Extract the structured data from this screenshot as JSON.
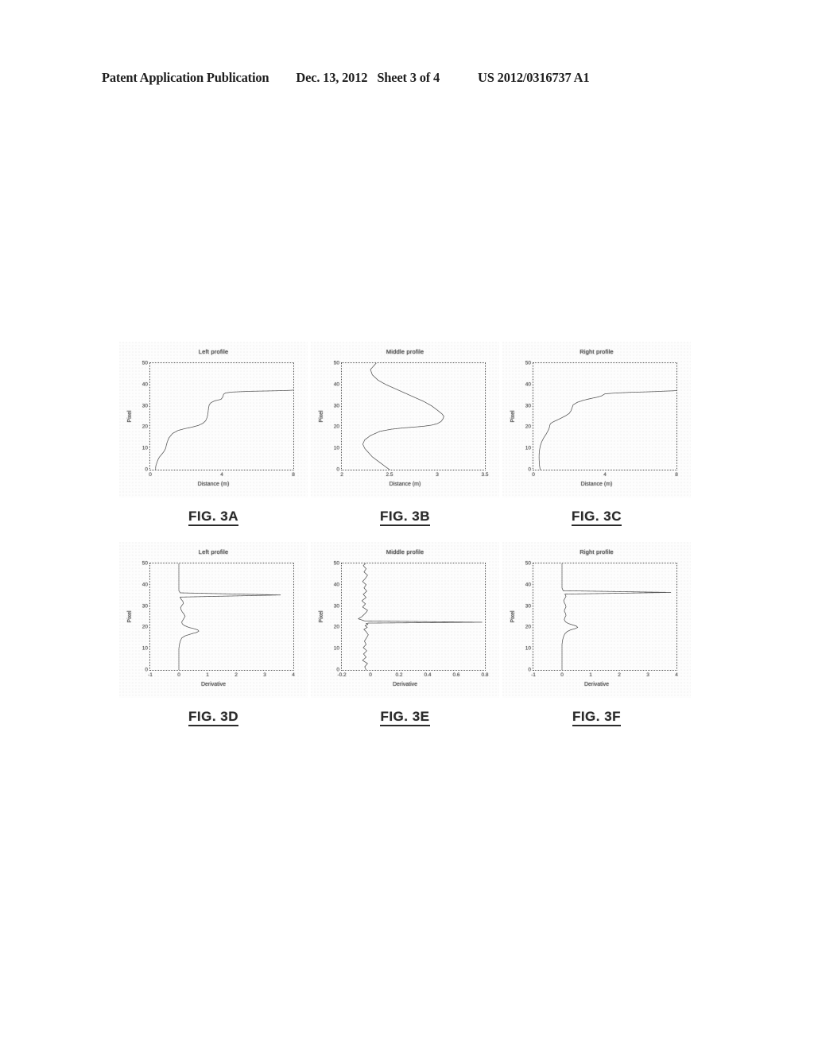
{
  "header": {
    "publication": "Patent Application Publication",
    "date": "Dec. 13, 2012",
    "sheet": "Sheet 3 of 4",
    "doc_number": "US 2012/0316737 A1"
  },
  "captions": {
    "a": "FIG. 3A",
    "b": "FIG. 3B",
    "c": "FIG. 3C",
    "d": "FIG. 3D",
    "e": "FIG. 3E",
    "f": "FIG. 3F"
  },
  "chart_data": [
    {
      "id": "fig3a",
      "type": "line",
      "title": "Left profile",
      "xlabel": "Distance (m)",
      "ylabel": "Pixel",
      "xlim": [
        0,
        8
      ],
      "ylim": [
        0,
        50
      ],
      "grid": false,
      "xticks": [
        "0",
        "4",
        "8"
      ],
      "xtick_values": [
        0,
        4,
        8
      ],
      "yticks": [
        "0",
        "10",
        "20",
        "30",
        "40",
        "50"
      ],
      "ytick_values": [
        0,
        10,
        20,
        30,
        40,
        50
      ],
      "series": [
        {
          "name": "Left profile",
          "x": [
            0.3,
            0.3,
            0.32,
            0.36,
            0.4,
            0.45,
            0.52,
            0.62,
            0.72,
            0.8,
            0.86,
            0.9,
            0.95,
            1.05,
            1.25,
            1.55,
            1.95,
            2.35,
            2.7,
            2.95,
            3.1,
            3.18,
            3.22,
            3.24,
            3.26,
            3.3,
            3.4,
            3.6,
            3.95,
            4.05,
            4.1,
            4.2,
            4.5,
            5.0,
            5.6,
            6.2,
            6.8,
            7.3,
            7.7,
            7.95,
            8.0
          ],
          "y": [
            0.0,
            1.0,
            2.0,
            3.0,
            4.0,
            5.0,
            6.0,
            7.0,
            8.0,
            9.0,
            10.0,
            11.5,
            13.0,
            15.0,
            17.0,
            18.4,
            19.3,
            20.0,
            20.8,
            21.8,
            23.0,
            24.5,
            26.0,
            27.5,
            29.0,
            30.5,
            31.5,
            32.3,
            33.0,
            34.0,
            35.4,
            36.0,
            36.4,
            36.6,
            36.8,
            36.9,
            37.0,
            37.1,
            37.2,
            37.3,
            37.4
          ]
        }
      ]
    },
    {
      "id": "fig3b",
      "type": "line",
      "title": "Middle profile",
      "xlabel": "Distance (m)",
      "ylabel": "Pixel",
      "xlim": [
        2,
        3.5
      ],
      "ylim": [
        0,
        50
      ],
      "grid": false,
      "xticks": [
        "2",
        "2.5",
        "3",
        "3.5"
      ],
      "xtick_values": [
        2,
        2.5,
        3,
        3.5
      ],
      "yticks": [
        "0",
        "10",
        "20",
        "30",
        "40",
        "50"
      ],
      "ytick_values": [
        0,
        10,
        20,
        30,
        40,
        50
      ],
      "series": [
        {
          "name": "Middle profile",
          "x": [
            2.5,
            2.44,
            2.38,
            2.32,
            2.28,
            2.24,
            2.22,
            2.24,
            2.3,
            2.4,
            2.52,
            2.64,
            2.76,
            2.86,
            2.94,
            3.0,
            3.04,
            3.06,
            3.07,
            3.05,
            3.0,
            2.94,
            2.86,
            2.76,
            2.66,
            2.56,
            2.46,
            2.38,
            2.32,
            2.3,
            2.36
          ],
          "y": [
            0.0,
            2.0,
            4.0,
            6.0,
            8.0,
            10.0,
            12.0,
            14.0,
            16.0,
            18.0,
            19.0,
            19.6,
            20.0,
            20.4,
            20.9,
            21.6,
            22.6,
            23.8,
            25.0,
            26.2,
            28.0,
            30.0,
            32.0,
            34.0,
            36.0,
            38.0,
            40.0,
            42.0,
            44.5,
            47.0,
            50.0
          ]
        }
      ]
    },
    {
      "id": "fig3c",
      "type": "line",
      "title": "Right profile",
      "xlabel": "Distance (m)",
      "ylabel": "Pixel",
      "xlim": [
        0,
        8
      ],
      "ylim": [
        0,
        50
      ],
      "grid": false,
      "xticks": [
        "0",
        "4",
        "8"
      ],
      "xtick_values": [
        0,
        4,
        8
      ],
      "yticks": [
        "0",
        "10",
        "20",
        "30",
        "40",
        "50"
      ],
      "ytick_values": [
        0,
        10,
        20,
        30,
        40,
        50
      ],
      "series": [
        {
          "name": "Right profile",
          "x": [
            0.38,
            0.36,
            0.34,
            0.33,
            0.32,
            0.32,
            0.34,
            0.38,
            0.46,
            0.58,
            0.7,
            0.8,
            0.86,
            0.9,
            0.92,
            0.96,
            1.02,
            1.12,
            1.3,
            1.55,
            1.8,
            2.0,
            2.1,
            2.16,
            2.22,
            2.45,
            2.8,
            3.2,
            3.55,
            3.8,
            4.0,
            4.6,
            5.4,
            6.2,
            6.9,
            7.4,
            7.75,
            7.95,
            8.0
          ],
          "y": [
            0.0,
            1.0,
            2.0,
            3.5,
            5.0,
            7.0,
            9.0,
            11.0,
            13.0,
            15.0,
            16.5,
            18.0,
            19.0,
            20.0,
            21.0,
            21.6,
            22.0,
            22.5,
            23.2,
            24.2,
            25.3,
            26.4,
            27.6,
            29.0,
            30.4,
            31.6,
            32.6,
            33.4,
            34.0,
            34.6,
            35.6,
            36.0,
            36.3,
            36.5,
            36.7,
            36.9,
            37.0,
            37.1,
            37.2
          ]
        }
      ]
    },
    {
      "id": "fig3d",
      "type": "line",
      "title": "Left profile",
      "xlabel": "Derivative",
      "ylabel": "Pixel",
      "xlim": [
        -1,
        4
      ],
      "ylim": [
        0,
        50
      ],
      "grid": false,
      "xticks": [
        "-1",
        "0",
        "1",
        "2",
        "3",
        "4"
      ],
      "xtick_values": [
        -1,
        0,
        1,
        2,
        3,
        4
      ],
      "yticks": [
        "0",
        "10",
        "20",
        "30",
        "40",
        "50"
      ],
      "ytick_values": [
        0,
        10,
        20,
        30,
        40,
        50
      ],
      "series": [
        {
          "name": "Left profile derivative",
          "x": [
            0.0,
            0.0,
            0.0,
            0.0,
            0.0,
            0.0,
            0.02,
            0.05,
            0.1,
            0.22,
            0.45,
            0.62,
            0.7,
            0.66,
            0.52,
            0.34,
            0.2,
            0.12,
            0.1,
            0.14,
            0.18,
            0.22,
            0.18,
            0.12,
            0.08,
            0.06,
            0.1,
            0.16,
            0.14,
            0.08,
            0.04,
            3.55,
            0.05,
            0.0,
            0.0,
            0.0,
            0.0,
            0.0,
            0.0,
            0.0,
            0.0
          ],
          "y": [
            0.0,
            2.0,
            4.0,
            6.0,
            8.0,
            10.0,
            12.0,
            13.5,
            15.0,
            16.0,
            17.0,
            17.6,
            18.2,
            18.8,
            19.4,
            20.0,
            20.8,
            21.6,
            22.5,
            23.4,
            24.3,
            25.2,
            26.2,
            27.2,
            28.2,
            29.2,
            30.2,
            31.2,
            32.2,
            33.2,
            34.2,
            35.2,
            36.2,
            37.2,
            39.0,
            41.0,
            43.0,
            45.0,
            47.0,
            49.0,
            50.0
          ]
        }
      ]
    },
    {
      "id": "fig3e",
      "type": "line",
      "title": "Middle profile",
      "xlabel": "Derivative",
      "ylabel": "Pixel",
      "xlim": [
        -0.2,
        0.8
      ],
      "ylim": [
        0,
        50
      ],
      "grid": false,
      "xticks": [
        "-0.2",
        "0",
        "0.2",
        "0.4",
        "0.6",
        "0.8"
      ],
      "xtick_values": [
        -0.2,
        0,
        0.2,
        0.4,
        0.6,
        0.8
      ],
      "yticks": [
        "0",
        "10",
        "20",
        "30",
        "40",
        "50"
      ],
      "ytick_values": [
        0,
        10,
        20,
        30,
        40,
        50
      ],
      "series": [
        {
          "name": "Middle profile derivative",
          "x": [
            -0.03,
            -0.04,
            -0.02,
            -0.055,
            -0.03,
            -0.048,
            -0.025,
            -0.05,
            -0.03,
            -0.042,
            -0.028,
            -0.015,
            -0.03,
            -0.046,
            -0.022,
            -0.038,
            -0.018,
            -0.03,
            -0.012,
            0.78,
            -0.04,
            -0.085,
            -0.06,
            -0.045,
            -0.03,
            -0.02,
            -0.055,
            -0.035,
            -0.06,
            -0.03,
            -0.05,
            -0.025,
            -0.045,
            -0.03,
            -0.055,
            -0.035,
            -0.02,
            -0.045,
            -0.03,
            -0.05,
            -0.035
          ],
          "y": [
            0.0,
            1.5,
            3.0,
            4.5,
            6.0,
            7.5,
            9.0,
            10.5,
            12.0,
            13.5,
            15.0,
            16.5,
            18.0,
            19.0,
            20.0,
            20.8,
            21.4,
            21.8,
            22.0,
            22.4,
            23.0,
            24.0,
            25.0,
            26.0,
            27.0,
            28.0,
            29.5,
            31.0,
            32.5,
            34.0,
            35.5,
            37.0,
            38.5,
            40.0,
            41.5,
            43.0,
            44.5,
            46.0,
            47.5,
            49.0,
            50.0
          ]
        }
      ]
    },
    {
      "id": "fig3f",
      "type": "line",
      "title": "Right profile",
      "xlabel": "Derivative",
      "ylabel": "Pixel",
      "xlim": [
        -1,
        4
      ],
      "ylim": [
        0,
        50
      ],
      "grid": false,
      "xticks": [
        "-1",
        "0",
        "1",
        "2",
        "3",
        "4"
      ],
      "xtick_values": [
        -1,
        0,
        1,
        2,
        3,
        4
      ],
      "yticks": [
        "0",
        "10",
        "20",
        "30",
        "40",
        "50"
      ],
      "ytick_values": [
        0,
        10,
        20,
        30,
        40,
        50
      ],
      "series": [
        {
          "name": "Right profile derivative",
          "x": [
            0.0,
            0.0,
            0.0,
            0.0,
            0.0,
            0.0,
            0.0,
            0.02,
            0.05,
            0.1,
            0.18,
            0.3,
            0.46,
            0.55,
            0.5,
            0.36,
            0.22,
            0.12,
            0.08,
            0.1,
            0.14,
            0.12,
            0.08,
            0.1,
            0.14,
            0.12,
            0.08,
            0.06,
            0.1,
            0.14,
            0.1,
            3.8,
            0.04,
            0.0,
            0.0,
            0.0,
            0.0,
            0.0,
            0.0,
            0.0,
            0.0
          ],
          "y": [
            0.0,
            2.0,
            4.0,
            6.0,
            8.0,
            10.0,
            12.0,
            14.0,
            15.5,
            17.0,
            18.0,
            18.8,
            19.4,
            20.0,
            20.6,
            21.2,
            21.8,
            22.6,
            23.6,
            24.6,
            25.6,
            26.6,
            27.6,
            28.6,
            29.6,
            30.6,
            31.6,
            32.6,
            33.6,
            34.6,
            35.6,
            36.4,
            37.2,
            38.5,
            40.0,
            42.0,
            44.0,
            46.0,
            48.0,
            49.5,
            50.0
          ]
        }
      ]
    }
  ]
}
